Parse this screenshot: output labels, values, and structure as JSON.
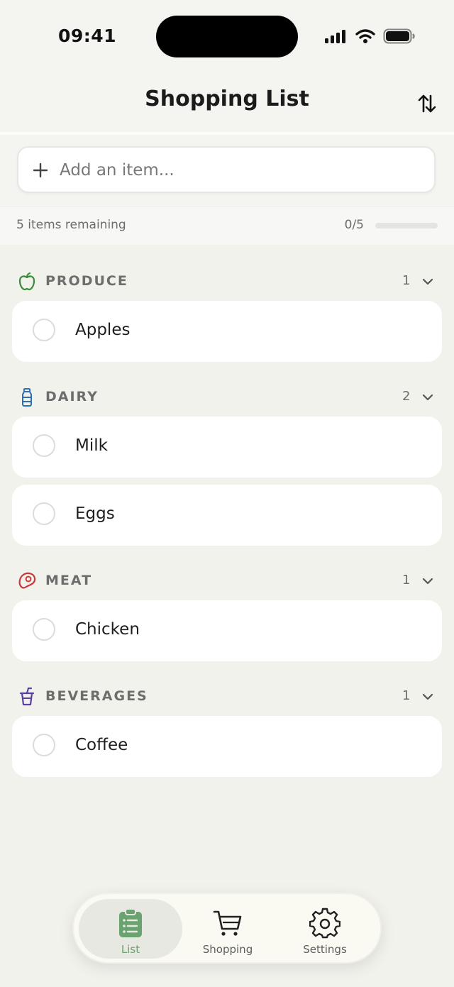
{
  "status_bar": {
    "time": "09:41"
  },
  "header": {
    "title": "Shopping List",
    "sort_icon": "sort-arrows-icon"
  },
  "add_item": {
    "placeholder": "Add an item...",
    "value": "",
    "icon": "plus-icon"
  },
  "progress": {
    "remaining_text": "5 items remaining",
    "count_text": "0/5",
    "fraction": 0
  },
  "categories": [
    {
      "name": "PRODUCE",
      "count": "1",
      "icon": "apple-icon",
      "color": "#3a8a3a",
      "items": [
        {
          "label": "Apples",
          "checked": false
        }
      ]
    },
    {
      "name": "DAIRY",
      "count": "2",
      "icon": "milk-bottle-icon",
      "color": "#2d6fb8",
      "items": [
        {
          "label": "Milk",
          "checked": false
        },
        {
          "label": "Eggs",
          "checked": false
        }
      ]
    },
    {
      "name": "MEAT",
      "count": "1",
      "icon": "steak-icon",
      "color": "#c8393a",
      "items": [
        {
          "label": "Chicken",
          "checked": false
        }
      ]
    },
    {
      "name": "BEVERAGES",
      "count": "1",
      "icon": "drink-cup-icon",
      "color": "#5a3fa6",
      "items": [
        {
          "label": "Coffee",
          "checked": false
        }
      ]
    }
  ],
  "tabs": [
    {
      "label": "List",
      "icon": "clipboard-list-icon",
      "active": true
    },
    {
      "label": "Shopping",
      "icon": "cart-icon",
      "active": false
    },
    {
      "label": "Settings",
      "icon": "gear-icon",
      "active": false
    }
  ],
  "colors": {
    "accent": "#6aa36f",
    "background": "#f2f2ed"
  }
}
